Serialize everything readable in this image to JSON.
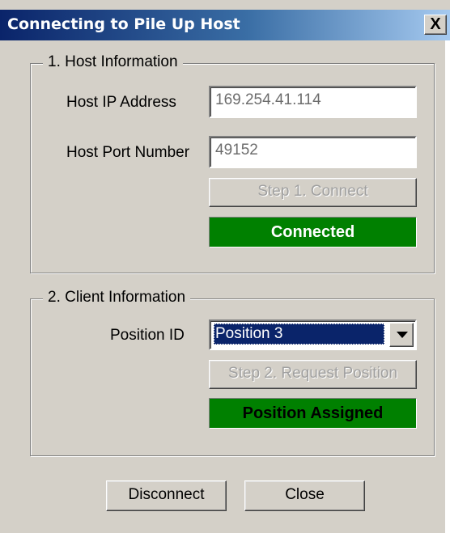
{
  "window": {
    "title": "Connecting to Pile Up Host",
    "close_glyph": "X"
  },
  "host": {
    "legend": "1. Host Information",
    "ip_label": "Host IP Address",
    "ip_value": "169.254.41.114",
    "port_label": "Host Port Number",
    "port_value": "49152",
    "connect_button": "Step 1. Connect",
    "status": "Connected"
  },
  "client": {
    "legend": "2. Client Information",
    "position_label": "Position ID",
    "position_value": "Position 3",
    "request_button": "Step 2. Request Position",
    "status": "Position Assigned"
  },
  "footer": {
    "disconnect_button": "Disconnect",
    "close_button": "Close"
  },
  "colors": {
    "status_green": "#008000",
    "title_blue": "#0a246a"
  },
  "icons": {
    "dropdown": "chevron-down-icon",
    "close": "close-icon"
  }
}
